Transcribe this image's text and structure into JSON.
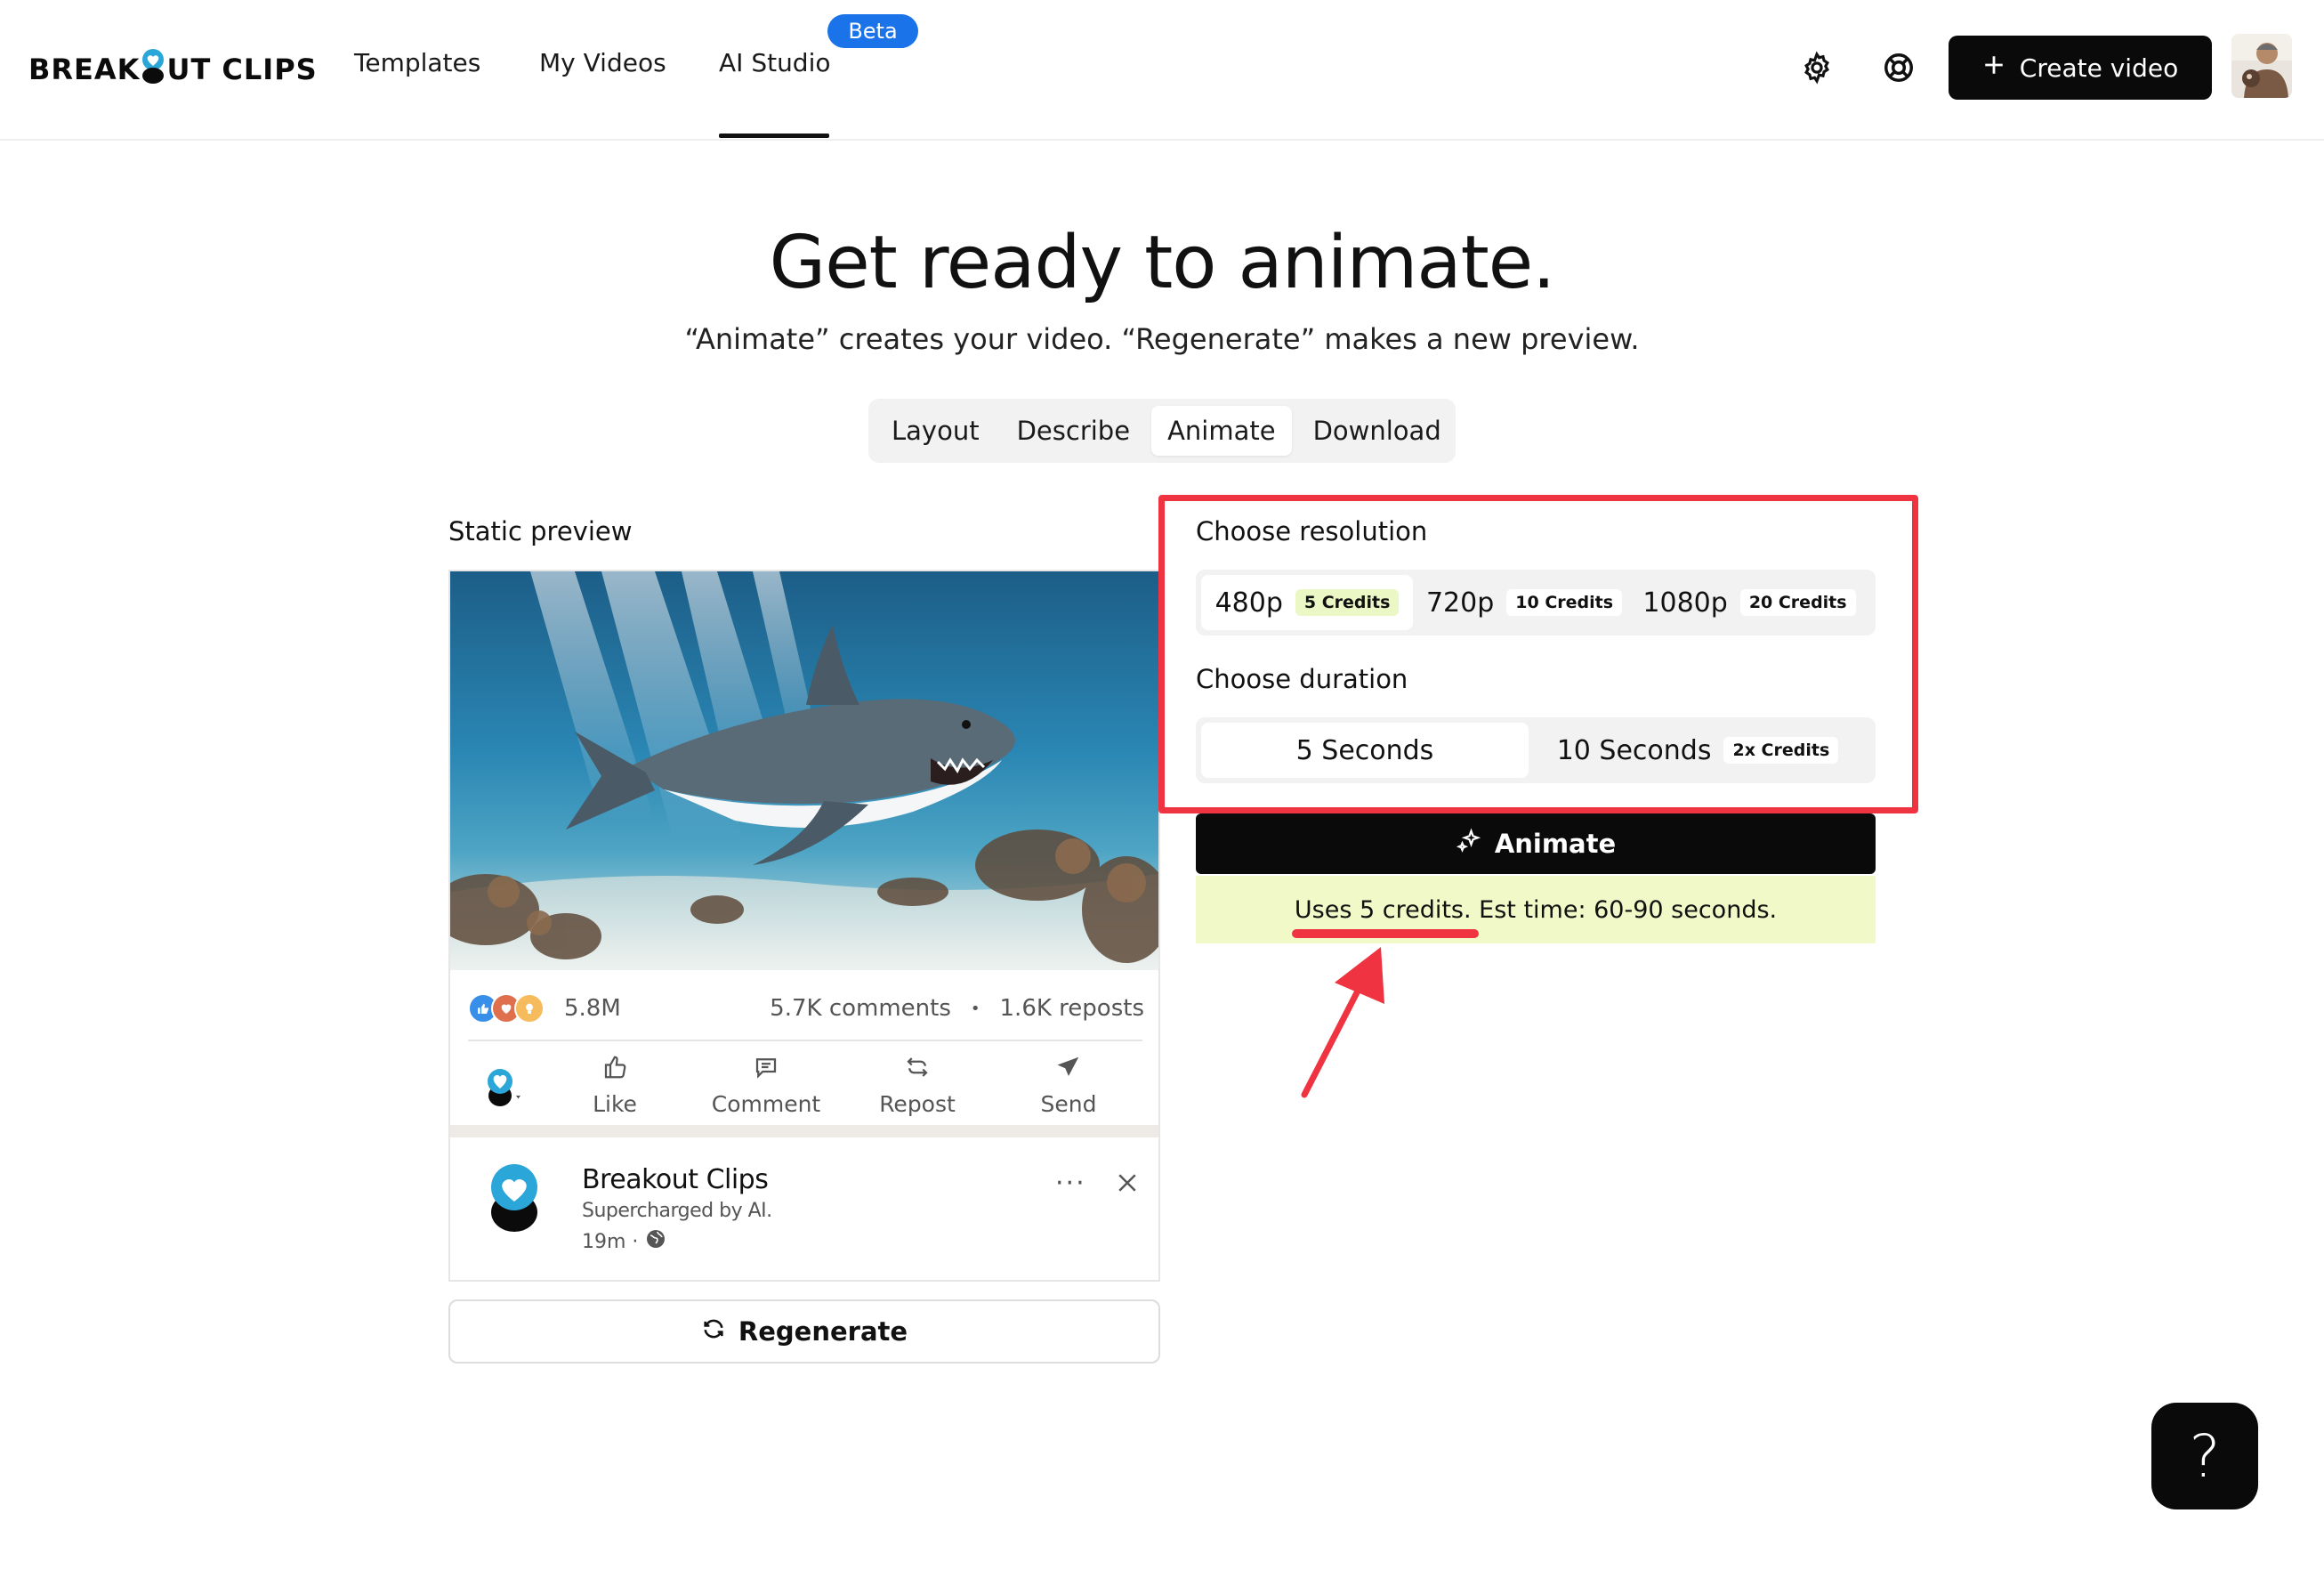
{
  "header": {
    "logo_text_left": "BREAK",
    "logo_text_right": "UT CLIPS",
    "nav": [
      "Templates",
      "My Videos",
      "AI Studio"
    ],
    "beta_label": "Beta",
    "create_label": "Create video",
    "icons": [
      "settings-icon",
      "help-lifebuoy-icon"
    ]
  },
  "hero": {
    "title": "Get ready to animate.",
    "subtitle": "“Animate” creates your video. “Regenerate” makes a new preview."
  },
  "steps": [
    "Layout",
    "Describe",
    "Animate",
    "Download"
  ],
  "preview": {
    "label": "Static preview",
    "reactions_count": "5.8M",
    "comments": "5.7K comments",
    "dot": "•",
    "reposts": "1.6K reposts",
    "actions": [
      "Like",
      "Comment",
      "Repost",
      "Send"
    ],
    "post_name": "Breakout Clips",
    "post_sub": "Supercharged by AI.",
    "post_time": "19m ·",
    "more": "···",
    "regenerate_label": "Regenerate"
  },
  "resolution": {
    "label": "Choose resolution",
    "options": [
      {
        "name": "480p",
        "credits": "5 Credits"
      },
      {
        "name": "720p",
        "credits": "10 Credits"
      },
      {
        "name": "1080p",
        "credits": "20 Credits"
      }
    ],
    "selected": "480p"
  },
  "duration": {
    "label": "Choose duration",
    "options": [
      {
        "name": "5 Seconds",
        "credits": ""
      },
      {
        "name": "10 Seconds",
        "credits": "2x Credits"
      }
    ],
    "selected": "5 Seconds"
  },
  "animate": {
    "label": "Animate",
    "info": "Uses 5 credits. Est time: 60-90 seconds."
  },
  "help_label": "?",
  "colors": {
    "accent_red": "#ef3340",
    "beta_blue": "#1a73e8",
    "highlight_green": "#f0f9c7",
    "brand_blue": "#2aa6d9"
  }
}
